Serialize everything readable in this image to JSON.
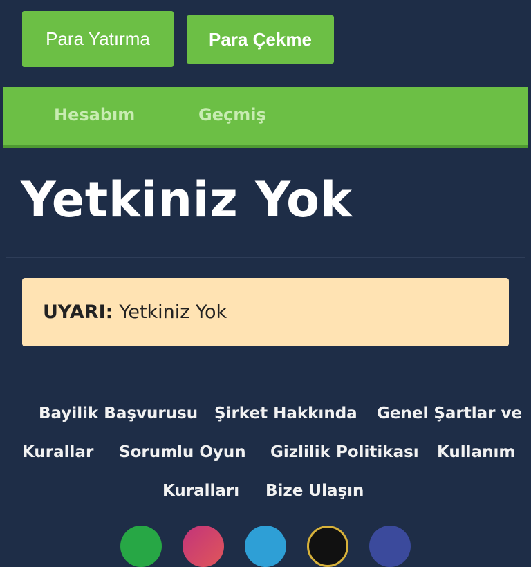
{
  "header": {
    "deposit_label": "Para Yatırma",
    "withdraw_label": "Para Çekme"
  },
  "nav": {
    "account": "Hesabım",
    "history": "Geçmiş"
  },
  "page": {
    "title": "Yetkiniz Yok"
  },
  "alert": {
    "label": "UYARI:",
    "message": "Yetkiniz Yok"
  },
  "footer": {
    "links": [
      "Bayilik Başvurusu",
      "Şirket Hakkında",
      "Genel Şartlar ve",
      "Kurallar",
      "Sorumlu Oyun",
      "Gizlilik Politikası",
      "Kullanım",
      "Kuralları",
      "Bize Ulaşın"
    ],
    "social_icons": [
      "whatsapp-icon",
      "instagram-icon",
      "telegram-icon",
      "support-icon",
      "facebook-icon"
    ]
  },
  "colors": {
    "background": "#1e2d47",
    "brand_green": "#6cbf45",
    "alert_bg": "#ffe3b3"
  }
}
